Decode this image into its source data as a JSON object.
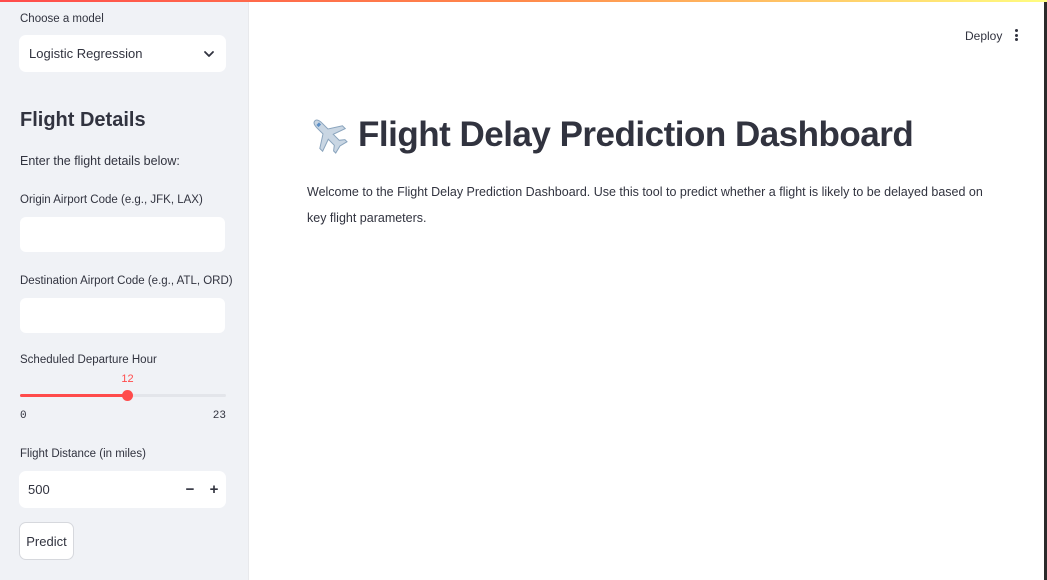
{
  "sidebar": {
    "model_label": "Choose a model",
    "model_value": "Logistic Regression",
    "heading": "Flight Details",
    "subtext": "Enter the flight details below:",
    "origin_label": "Origin Airport Code (e.g., JFK, LAX)",
    "origin_value": "",
    "destination_label": "Destination Airport Code (e.g., ATL, ORD)",
    "destination_value": "",
    "departure_label": "Scheduled Departure Hour",
    "departure": {
      "value": 12,
      "value_text": "12",
      "min": 0,
      "min_text": "0",
      "max": 23,
      "max_text": "23"
    },
    "distance_label": "Flight Distance (in miles)",
    "distance_value": "500",
    "minus_label": "−",
    "plus_label": "+",
    "predict_label": "Predict"
  },
  "header": {
    "deploy_label": "Deploy",
    "menu_icon": "kebab-menu-icon"
  },
  "main": {
    "title_icon": "airplane-icon",
    "title": "Flight Delay Prediction Dashboard",
    "welcome": "Welcome to the Flight Delay Prediction Dashboard. Use this tool to predict whether a flight is likely to be delayed based on key flight parameters."
  },
  "colors": {
    "accent": "#ff4b4b",
    "sidebar_bg": "#f0f2f6",
    "text": "#31333f"
  }
}
